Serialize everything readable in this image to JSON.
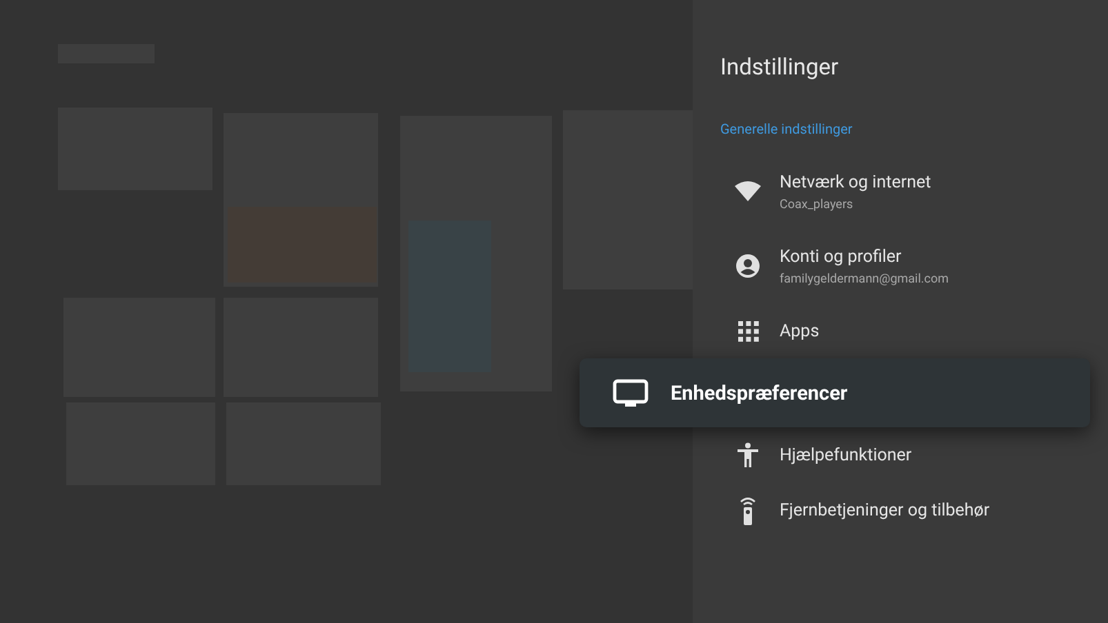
{
  "settings_panel": {
    "title": "Indstillinger",
    "section_header": "Generelle indstillinger",
    "items": [
      {
        "label": "Netværk og internet",
        "subtitle": "Coax_players",
        "selected": false
      },
      {
        "label": "Konti og profiler",
        "subtitle": "familygeldermann@gmail.com",
        "selected": false
      },
      {
        "label": "Apps",
        "selected": false
      },
      {
        "label": "Enhedspræferencer",
        "selected": true
      },
      {
        "label": "Hjælpefunktioner",
        "selected": false
      },
      {
        "label": "Fjernbetjeninger og tilbehør",
        "selected": false
      }
    ]
  }
}
